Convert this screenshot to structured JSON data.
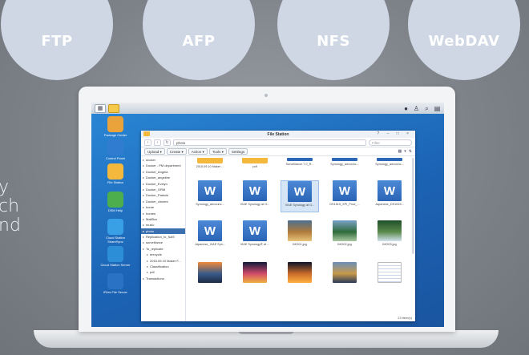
{
  "protocols": [
    "FTP",
    "AFP",
    "NFS",
    "WebDAV"
  ],
  "side_text": [
    "y",
    "ch",
    "nd"
  ],
  "taskbar": {
    "right_icons": [
      "user-icon",
      "person-icon",
      "search-icon",
      "widgets-icon"
    ]
  },
  "desktop_icons": [
    {
      "label": "Package Center",
      "icon": "package-icon",
      "color": "#e9a33a"
    },
    {
      "label": "Control Panel",
      "icon": "control-panel-icon",
      "color": "#2f7cd0"
    },
    {
      "label": "File Station",
      "icon": "folder-icon",
      "color": "#f4b93c"
    },
    {
      "label": "DSM Help",
      "icon": "help-icon",
      "color": "#4cae4c"
    },
    {
      "label": "Cloud Station ShareSync",
      "icon": "cloud-icon",
      "color": "#3aa0e6"
    },
    {
      "label": "Cloud Station Server",
      "icon": "cloud-server-icon",
      "color": "#2d8ed8"
    },
    {
      "label": "iFiles File Server",
      "icon": "file-server-icon",
      "color": "#2a73c4"
    }
  ],
  "file_station": {
    "title": "File Station",
    "path": "photo",
    "filter_placeholder": "Filter",
    "toolbar": [
      "Upload ▾",
      "Create ▾",
      "Action ▾",
      "Tools ▾",
      "Settings"
    ],
    "tree": [
      {
        "label": "docker",
        "sel": false,
        "child": false
      },
      {
        "label": "Docker - PM department",
        "sel": false,
        "child": false
      },
      {
        "label": "Docker_Angela",
        "sel": false,
        "child": false
      },
      {
        "label": "Docker_angeline",
        "sel": false,
        "child": false
      },
      {
        "label": "Docker_Evelyn",
        "sel": false,
        "child": false
      },
      {
        "label": "Docker_GRM",
        "sel": false,
        "child": false
      },
      {
        "label": "Docker_PatrickI",
        "sel": false,
        "child": false
      },
      {
        "label": "Docker_vincent",
        "sel": false,
        "child": false
      },
      {
        "label": "home",
        "sel": false,
        "child": false
      },
      {
        "label": "homes",
        "sel": false,
        "child": false
      },
      {
        "label": "MailBox",
        "sel": false,
        "child": false
      },
      {
        "label": "music",
        "sel": false,
        "child": false
      },
      {
        "label": "photo",
        "sel": true,
        "child": false
      },
      {
        "label": "Replication_to_NAS",
        "sel": false,
        "child": false
      },
      {
        "label": "surveillance",
        "sel": false,
        "child": false
      },
      {
        "label": "To_replicate",
        "sel": false,
        "child": false
      },
      {
        "label": "#recycle",
        "sel": false,
        "child": true
      },
      {
        "label": "2015.09.10 Maker F...",
        "sel": false,
        "child": true
      },
      {
        "label": "Classification",
        "sel": false,
        "child": true
      },
      {
        "label": "pdf",
        "sel": false,
        "child": true
      },
      {
        "label": "Transactions",
        "sel": false,
        "child": false
      }
    ],
    "files": [
      {
        "name": "2015.09.10 Maker ...",
        "type": "folder"
      },
      {
        "name": "pdf",
        "type": "folder"
      },
      {
        "name": "Surveillance 7.0_R...",
        "type": "bar"
      },
      {
        "name": "Synology_announc...",
        "type": "bar"
      },
      {
        "name": "Synology_announc...",
        "type": "bar"
      },
      {
        "name": "Synology_announc...",
        "type": "word"
      },
      {
        "name": "VIAE Synology at G...",
        "type": "word"
      },
      {
        "name": "VIAE Synology at G...",
        "type": "word",
        "sel": true
      },
      {
        "name": "DS1515_XPI_Prod_...",
        "type": "word"
      },
      {
        "name": "Japanese_DS1515...",
        "type": "word"
      },
      {
        "name": "Japanese_VIAE Syn...",
        "type": "word"
      },
      {
        "name": "VIAE Synology® at ...",
        "type": "word"
      },
      {
        "name": "IMG01.jpg",
        "type": "photo",
        "colors": [
          "#4b6f8f",
          "#b07a3a",
          "#e8c47a"
        ]
      },
      {
        "name": "IMG02.jpg",
        "type": "photo",
        "colors": [
          "#7aa0c8",
          "#2f6b3a",
          "#a9c7a0"
        ]
      },
      {
        "name": "IMG03.jpg",
        "type": "photo",
        "colors": [
          "#1f4f2a",
          "#5a8a4a",
          "#d2e2f0"
        ]
      },
      {
        "name": "",
        "type": "photo",
        "colors": [
          "#f08a3a",
          "#3a5b8a",
          "#1c2b44"
        ]
      },
      {
        "name": "",
        "type": "photo",
        "colors": [
          "#0f1a3a",
          "#d04a6a",
          "#f0b040"
        ]
      },
      {
        "name": "",
        "type": "photo",
        "colors": [
          "#0c1428",
          "#c86a2a",
          "#ffb040"
        ]
      },
      {
        "name": "",
        "type": "photo",
        "colors": [
          "#6a8fb8",
          "#c89a4a",
          "#2a3a5a"
        ]
      },
      {
        "name": "",
        "type": "doc"
      }
    ],
    "status": "23 item(s)"
  }
}
